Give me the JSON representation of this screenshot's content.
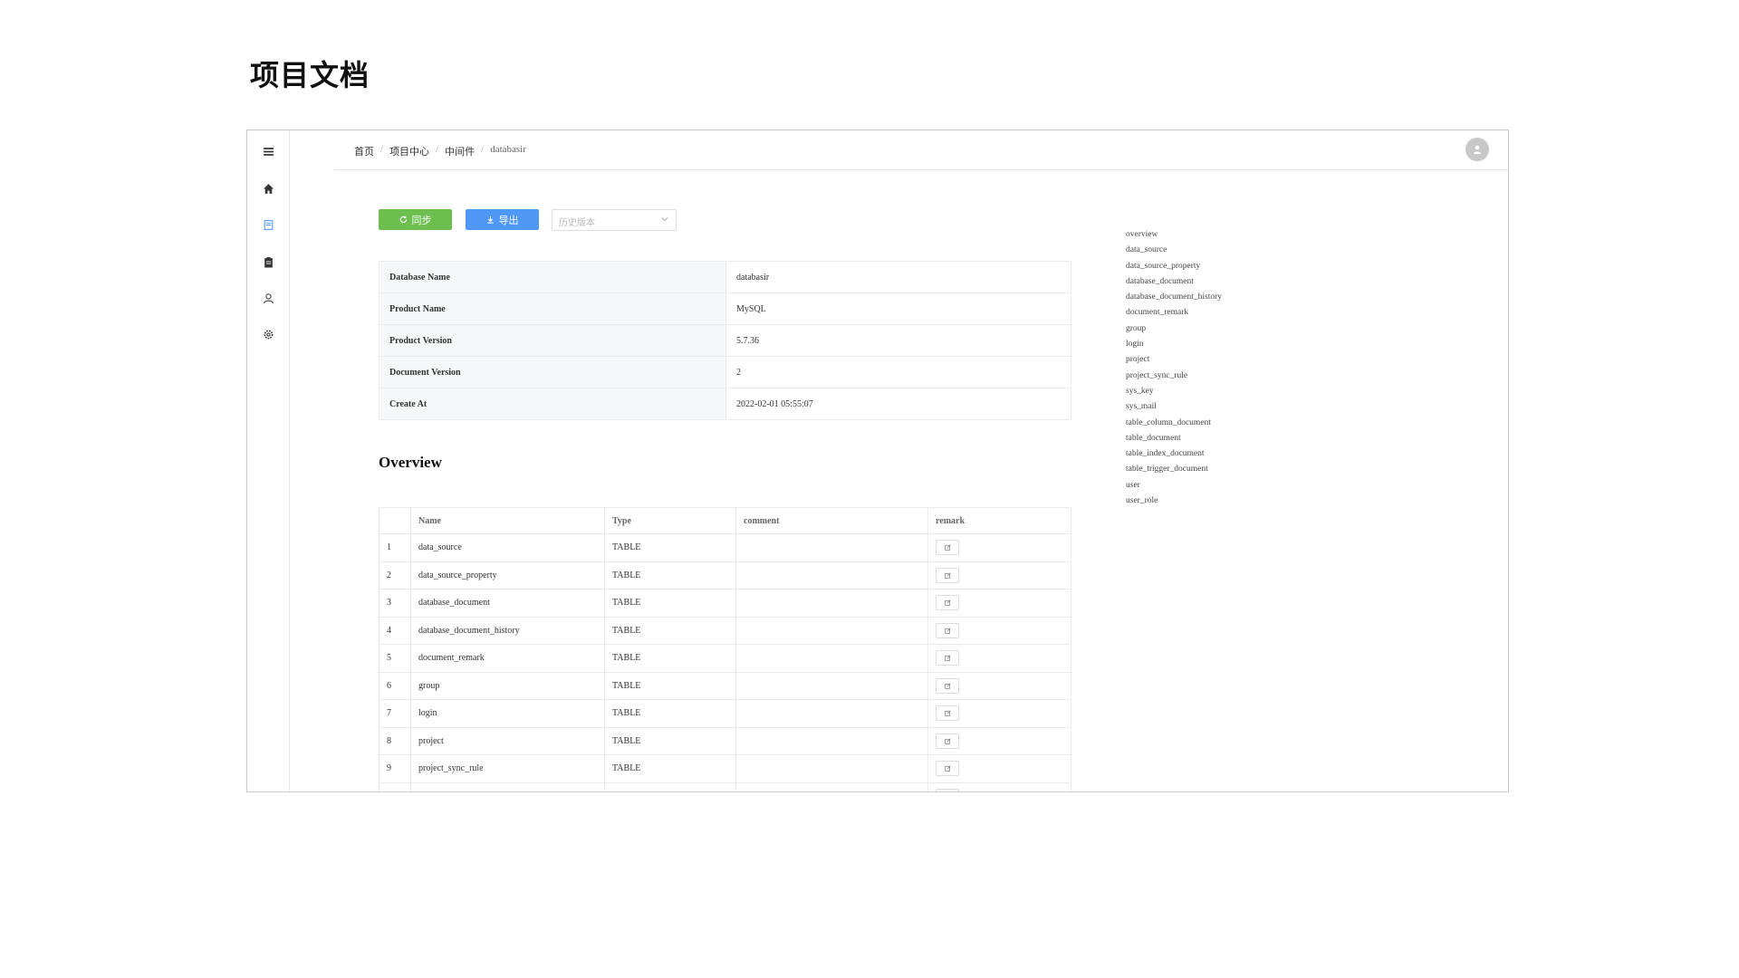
{
  "slide": {
    "title": "项目文档"
  },
  "breadcrumb": [
    "首页",
    "项目中心",
    "中间件",
    "databasir"
  ],
  "toolbar": {
    "sync_label": "同步",
    "export_label": "导出",
    "version_placeholder": "历史版本"
  },
  "info": [
    {
      "key": "Database Name",
      "value": "databasir"
    },
    {
      "key": "Product Name",
      "value": "MySQL"
    },
    {
      "key": "Product Version",
      "value": "5.7.36"
    },
    {
      "key": "Document Version",
      "value": "2"
    },
    {
      "key": "Create At",
      "value": "2022-02-01 05:55:07"
    }
  ],
  "overview": {
    "title": "Overview",
    "columns": [
      "",
      "Name",
      "Type",
      "comment",
      "remark"
    ],
    "rows": [
      {
        "idx": "1",
        "name": "data_source",
        "type": "TABLE",
        "comment": ""
      },
      {
        "idx": "2",
        "name": "data_source_property",
        "type": "TABLE",
        "comment": ""
      },
      {
        "idx": "3",
        "name": "database_document",
        "type": "TABLE",
        "comment": ""
      },
      {
        "idx": "4",
        "name": "database_document_history",
        "type": "TABLE",
        "comment": ""
      },
      {
        "idx": "5",
        "name": "document_remark",
        "type": "TABLE",
        "comment": ""
      },
      {
        "idx": "6",
        "name": "group",
        "type": "TABLE",
        "comment": ""
      },
      {
        "idx": "7",
        "name": "login",
        "type": "TABLE",
        "comment": ""
      },
      {
        "idx": "8",
        "name": "project",
        "type": "TABLE",
        "comment": ""
      },
      {
        "idx": "9",
        "name": "project_sync_rule",
        "type": "TABLE",
        "comment": ""
      },
      {
        "idx": "",
        "name": "",
        "type": "",
        "comment": ""
      }
    ]
  },
  "toc": [
    "overview",
    "data_source",
    "data_source_property",
    "database_document",
    "database_document_history",
    "document_remark",
    "group",
    "login",
    "project",
    "project_sync_rule",
    "sys_key",
    "sys_mail",
    "table_column_document",
    "table_document",
    "table_index_document",
    "table_trigger_document",
    "user",
    "user_role"
  ],
  "sidebar_icons": [
    "menu-icon",
    "home-icon",
    "document-icon",
    "clipboard-icon",
    "user-icon",
    "settings-icon"
  ],
  "colors": {
    "sync": "#6cbf4f",
    "export": "#4f98f5",
    "active_icon": "#4f98f5"
  }
}
